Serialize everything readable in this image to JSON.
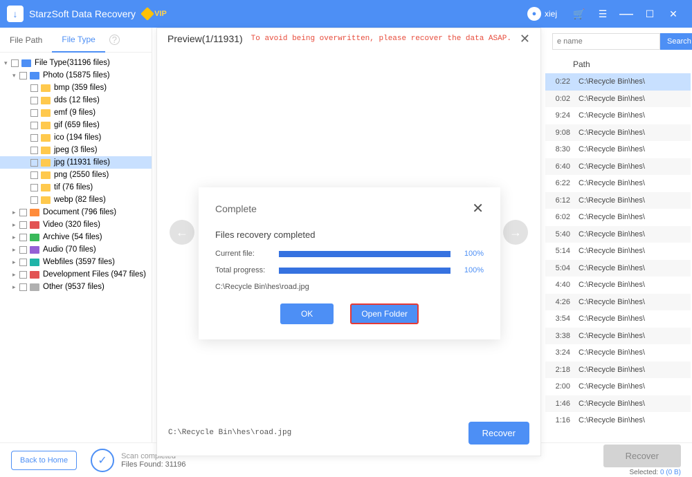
{
  "title_bar": {
    "app_name": "StarzSoft Data Recovery",
    "vip_label": "VIP",
    "username": "xiej"
  },
  "search": {
    "placeholder": "e name",
    "button": "Search"
  },
  "tabs": {
    "file_path": "File Path",
    "file_type": "File Type"
  },
  "tree": {
    "root": "File Type(31196 files)",
    "photo": "Photo  (15875 files)",
    "bmp": "bmp  (359 files)",
    "dds": "dds  (12 files)",
    "emf": "emf  (9 files)",
    "gif": "gif  (659 files)",
    "ico": "ico  (194 files)",
    "jpeg": "jpeg  (3 files)",
    "jpg": "jpg  (11931 files)",
    "png": "png  (2550 files)",
    "tif": "tif  (76 files)",
    "webp": "webp  (82 files)",
    "document": "Document  (796 files)",
    "video": "Video  (320 files)",
    "archive": "Archive  (54 files)",
    "audio": "Audio  (70 files)",
    "webfiles": "Webfiles  (3597 files)",
    "devfiles": "Development Files  (947 files)",
    "other": "Other  (9537 files)"
  },
  "table": {
    "path_header": "Path",
    "rows": [
      {
        "time": "0:22",
        "path": "C:\\Recycle Bin\\hes\\"
      },
      {
        "time": "0:02",
        "path": "C:\\Recycle Bin\\hes\\"
      },
      {
        "time": "9:24",
        "path": "C:\\Recycle Bin\\hes\\"
      },
      {
        "time": "9:08",
        "path": "C:\\Recycle Bin\\hes\\"
      },
      {
        "time": "8:30",
        "path": "C:\\Recycle Bin\\hes\\"
      },
      {
        "time": "6:40",
        "path": "C:\\Recycle Bin\\hes\\"
      },
      {
        "time": "6:22",
        "path": "C:\\Recycle Bin\\hes\\"
      },
      {
        "time": "6:12",
        "path": "C:\\Recycle Bin\\hes\\"
      },
      {
        "time": "6:02",
        "path": "C:\\Recycle Bin\\hes\\"
      },
      {
        "time": "5:40",
        "path": "C:\\Recycle Bin\\hes\\"
      },
      {
        "time": "5:14",
        "path": "C:\\Recycle Bin\\hes\\"
      },
      {
        "time": "5:04",
        "path": "C:\\Recycle Bin\\hes\\"
      },
      {
        "time": "4:40",
        "path": "C:\\Recycle Bin\\hes\\"
      },
      {
        "time": "4:26",
        "path": "C:\\Recycle Bin\\hes\\"
      },
      {
        "time": "3:54",
        "path": "C:\\Recycle Bin\\hes\\"
      },
      {
        "time": "3:38",
        "path": "C:\\Recycle Bin\\hes\\"
      },
      {
        "time": "3:24",
        "path": "C:\\Recycle Bin\\hes\\"
      },
      {
        "time": "2:18",
        "path": "C:\\Recycle Bin\\hes\\"
      },
      {
        "time": "2:00",
        "path": "C:\\Recycle Bin\\hes\\"
      },
      {
        "time": "1:46",
        "path": "C:\\Recycle Bin\\hes\\"
      },
      {
        "time": "1:16",
        "path": "C:\\Recycle Bin\\hes\\"
      }
    ]
  },
  "preview": {
    "title": "Preview(1/11931)",
    "warning": "To avoid being overwritten, please recover the data ASAP.",
    "footer_path": "C:\\Recycle Bin\\hes\\road.jpg",
    "recover_label": "Recover"
  },
  "complete": {
    "title": "Complete",
    "subtitle": "Files recovery completed",
    "current_label": "Current file:",
    "current_pct": "100%",
    "total_label": "Total progress:",
    "total_pct": "100%",
    "path": "C:\\Recycle Bin\\hes\\road.jpg",
    "ok_label": "OK",
    "open_label": "Open Folder"
  },
  "bottom": {
    "back_label": "Back to Home",
    "scan_status": "Scan completed",
    "files_found": "Files Found: 31196",
    "recover_label": "Recover",
    "selected_label": "Selected:",
    "selected_value": "0 (0 B)"
  }
}
